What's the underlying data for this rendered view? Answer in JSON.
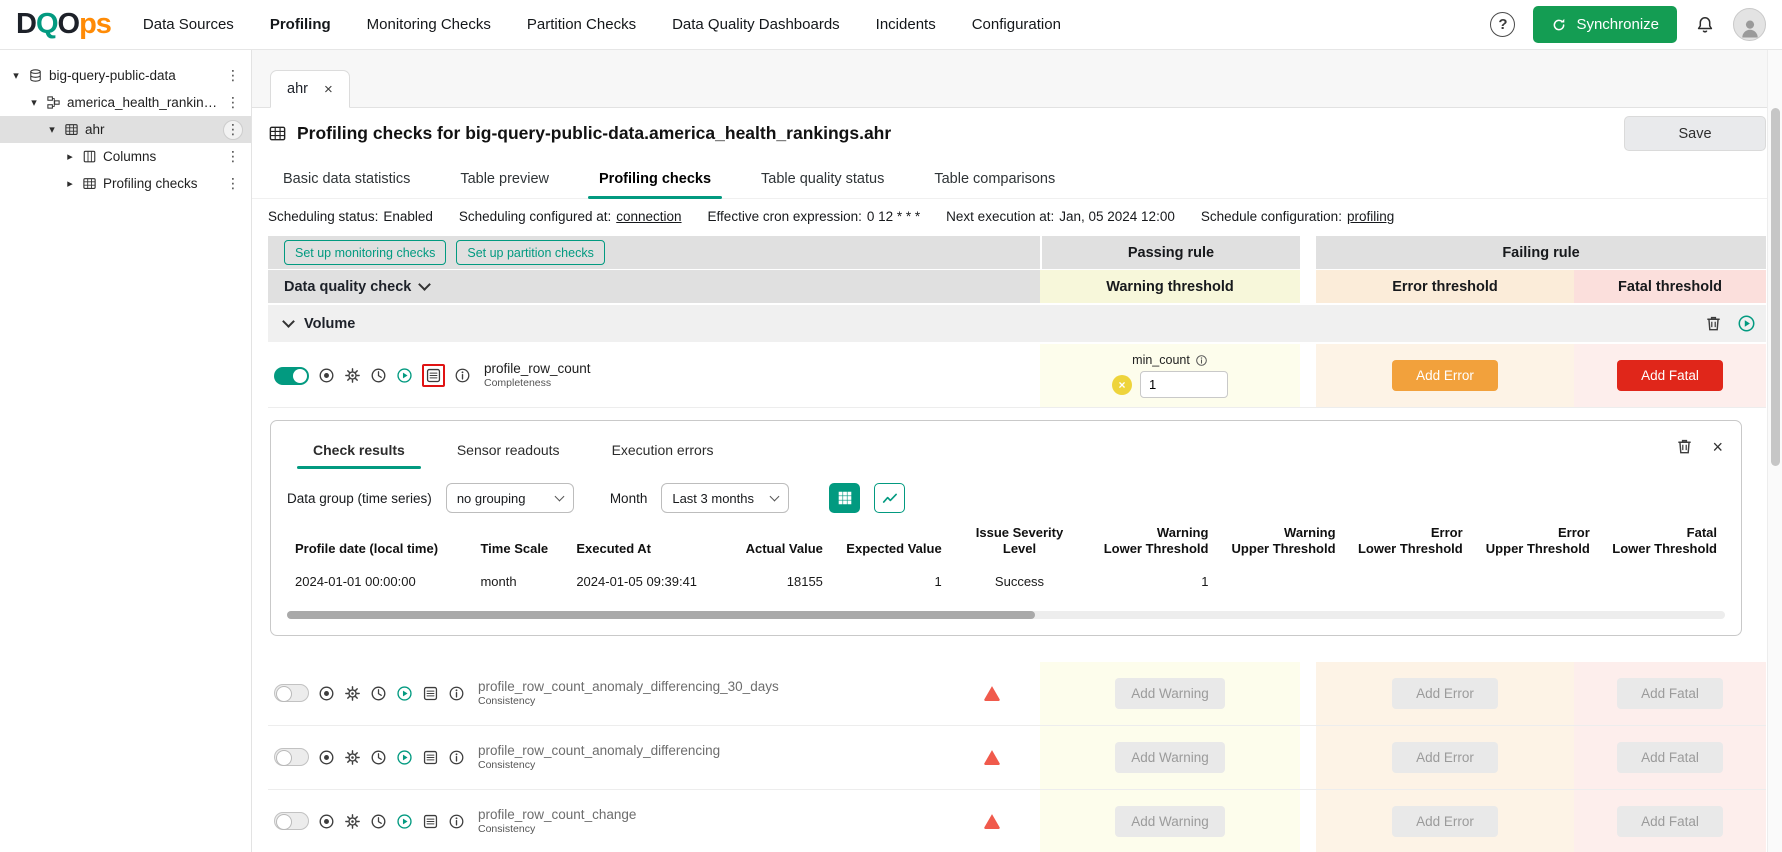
{
  "navbar": {
    "logo": {
      "d": "D",
      "q": "Q",
      "o": "O",
      "ps": "ps"
    },
    "items": [
      {
        "label": "Data Sources"
      },
      {
        "label": "Profiling"
      },
      {
        "label": "Monitoring Checks"
      },
      {
        "label": "Partition Checks"
      },
      {
        "label": "Data Quality Dashboards"
      },
      {
        "label": "Incidents"
      },
      {
        "label": "Configuration"
      }
    ],
    "synchronize_label": "Synchronize"
  },
  "sidebar": {
    "tree": [
      {
        "label": "big-query-public-data"
      },
      {
        "label": "america_health_rankings"
      },
      {
        "label": "ahr"
      },
      {
        "label": "Columns"
      },
      {
        "label": "Profiling checks"
      }
    ]
  },
  "main": {
    "doc_tab_label": "ahr",
    "page_title": "Profiling checks for big-query-public-data.america_health_rankings.ahr",
    "save_label": "Save",
    "tabs": [
      {
        "label": "Basic data statistics"
      },
      {
        "label": "Table preview"
      },
      {
        "label": "Profiling checks"
      },
      {
        "label": "Table quality status"
      },
      {
        "label": "Table comparisons"
      }
    ],
    "scheduling": {
      "status_label": "Scheduling status:",
      "status_value": "Enabled",
      "configured_label": "Scheduling configured at:",
      "configured_value": "connection",
      "cron_label": "Effective cron expression:",
      "cron_value": "0 12 * * *",
      "next_label": "Next execution at:",
      "next_value": "Jan, 05 2024 12:00",
      "config_label": "Schedule configuration:",
      "config_value": "profiling"
    }
  },
  "checks_table": {
    "setup_monitoring_label": "Set up monitoring checks",
    "setup_partition_label": "Set up partition checks",
    "passing_rule_label": "Passing rule",
    "failing_rule_label": "Failing rule",
    "data_quality_check_label": "Data quality check",
    "warning_threshold_label": "Warning threshold",
    "error_threshold_label": "Error threshold",
    "fatal_threshold_label": "Fatal threshold",
    "section_label": "Volume",
    "add_warning_label": "Add Warning",
    "add_error_label": "Add Error",
    "add_fatal_label": "Add Fatal",
    "active_check": {
      "name": "profile_row_count",
      "category": "Completeness",
      "rule_label": "min_count",
      "rule_value": "1"
    },
    "disabled_checks": [
      {
        "name": "profile_row_count_anomaly_differencing_30_days",
        "category": "Consistency"
      },
      {
        "name": "profile_row_count_anomaly_differencing",
        "category": "Consistency"
      },
      {
        "name": "profile_row_count_change",
        "category": "Consistency"
      }
    ]
  },
  "results_panel": {
    "tabs": [
      {
        "label": "Check results"
      },
      {
        "label": "Sensor readouts"
      },
      {
        "label": "Execution errors"
      }
    ],
    "data_group_label": "Data group (time series)",
    "data_group_value": "no grouping",
    "month_label": "Month",
    "month_value": "Last 3 months",
    "table": {
      "headers": [
        "Profile date (local time)",
        "Time Scale",
        "Executed At",
        "Actual Value",
        "Expected Value",
        "Issue Severity Level",
        "Warning\nLower Threshold",
        "Warning\nUpper Threshold",
        "Error\nLower Threshold",
        "Error\nUpper Threshold",
        "Fatal\nLower Threshold"
      ],
      "rows": [
        [
          "2024-01-01 00:00:00",
          "month",
          "2024-01-05 09:39:41",
          "18155",
          "1",
          "Success",
          "1",
          "",
          "",
          "",
          ""
        ]
      ]
    }
  },
  "icons": {
    "kebab": "⋮",
    "close": "×",
    "help": "?",
    "collapse_left": "‹",
    "tree_expanded": "▾",
    "tree_collapsed": "▸"
  },
  "colors": {
    "accent_teal": "#029a80",
    "synchronize_green": "#149d53",
    "add_error_orange": "#f2a13c",
    "add_fatal_red": "#e0261a",
    "warning_bg": "#fdfdec",
    "error_bg": "#fdf3e6",
    "fatal_bg": "#fdeeec",
    "header_gray": "#e0e0e0"
  }
}
